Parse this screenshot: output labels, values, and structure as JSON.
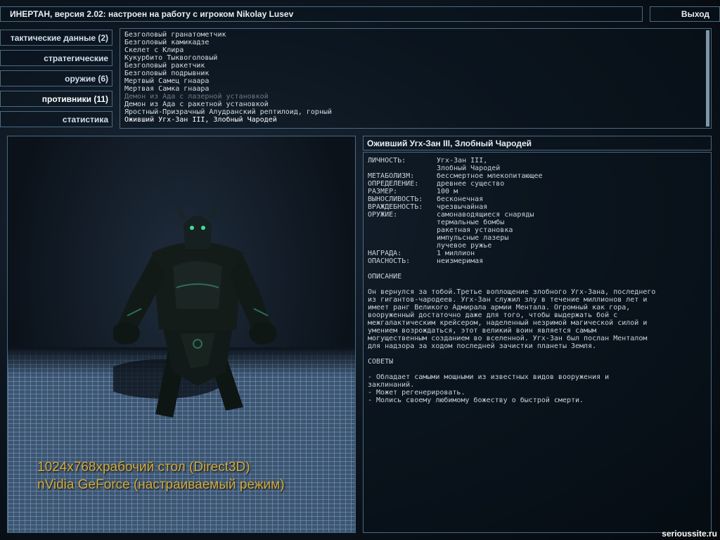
{
  "title": "ИНЕРТАН, версия 2.02: настроен на работу с игроком Nikolay Lusev",
  "exit_label": "Выход",
  "nav": [
    {
      "label": "тактические данные (2)"
    },
    {
      "label": "стратегические"
    },
    {
      "label": "оружие (6)"
    },
    {
      "label": "противники (11)"
    },
    {
      "label": "статистика"
    }
  ],
  "enemies": [
    "Безголовый гранатометчик",
    "Безголовый камикадзе",
    "Скелет с Клира",
    "Кукурбито Тыквоголовый",
    "Безголовый ракетчик",
    "Безголовый подрывник",
    "Мертвый Самец гнаара",
    "Мертвая Самка гнаара",
    "Демон из Ада с лазерной установкой",
    "Демон из Ада с ракетной установкой",
    "Яростный-Призрачный Алудранский рептилоид, горный",
    "Оживший Угх-Зан III, Злобный Чародей"
  ],
  "render_info": {
    "line1": "1024x768xрабочий стол (Direct3D)",
    "line2": "nVidia GeForce (настраиваемый режим)"
  },
  "info": {
    "header": "Оживший Угх-Зан III, Злобный Чародей",
    "props": [
      {
        "k": "ЛИЧНОСТЬ:",
        "v": "Угх-Зан III,\nЗлобный Чародей"
      },
      {
        "k": "МЕТАБОЛИЗМ:",
        "v": "бессмертное млекопитающее"
      },
      {
        "k": "ОПРЕДЕЛЕНИЕ:",
        "v": "древнее существо"
      },
      {
        "k": "РАЗМЕР:",
        "v": "100 м"
      },
      {
        "k": "ВЫНОСЛИВОСТЬ:",
        "v": "бесконечная"
      },
      {
        "k": "ВРАЖДЕБНОСТЬ:",
        "v": "чрезвычайная"
      },
      {
        "k": "ОРУЖИЕ:",
        "v": "самонаводящиеся снаряды\nтермальные бомбы\nракетная установка\nимпульсные лазеры\nлучевое ружье"
      },
      {
        "k": "НАГРАДА:",
        "v": "1 миллион"
      },
      {
        "k": "ОПАСНОСТЬ:",
        "v": "неизмеримая"
      }
    ],
    "description_title": "ОПИСАНИЕ",
    "description": "Он вернулся за тобой.Третье воплощение злобного Угх-Зана, последнего\nиз гигантов-чародеев. Угх-Зан служил злу в течение миллионов лет и\nимеет ранг Великого Адмирала армии Ментала. Огромный как гора,\nвооруженный достаточно даже для того, чтобы выдержать бой с\nмежгалактическим крейсером, наделенный незримой магической силой и\nумением возрождаться, этот великий воин является самым\nмогущественным созданием во вселенной. Угх-Зан был послан Менталом\nдля надзора за ходом последней зачистки планеты Земля.",
    "tips_title": "СОВЕТЫ",
    "tips": "- Обладает самыми мощными из известных видов вооружения и\nзаклинаний.\n- Может регенерировать.\n- Молись своему любимому божеству о быстрой смерти."
  },
  "watermark": "serioussite.ru",
  "colors": {
    "border": "#4a6a82",
    "accent_text": "#d3a93a",
    "dim_text": "#6d7a85"
  }
}
